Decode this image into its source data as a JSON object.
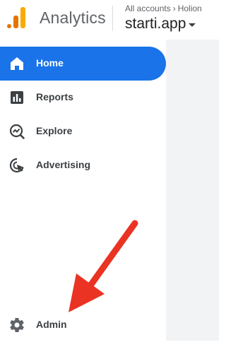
{
  "header": {
    "app_name": "Analytics",
    "account_crumb": {
      "all_accounts": "All accounts",
      "separator": ">",
      "account": "Holion"
    },
    "property": "starti.app",
    "logo_icon": "analytics-logo-icon"
  },
  "sidebar": {
    "items": [
      {
        "label": "Home",
        "icon": "home-icon",
        "active": true
      },
      {
        "label": "Reports",
        "icon": "reports-icon",
        "active": false
      },
      {
        "label": "Explore",
        "icon": "explore-icon",
        "active": false
      },
      {
        "label": "Advertising",
        "icon": "advertising-icon",
        "active": false
      },
      {
        "label": "Admin",
        "icon": "gear-icon",
        "active": false
      }
    ]
  },
  "colors": {
    "accent": "#1a73e8",
    "annotation_arrow": "#ea3323",
    "logo_orange": "#e37400",
    "logo_yellow": "#f9ab00"
  }
}
